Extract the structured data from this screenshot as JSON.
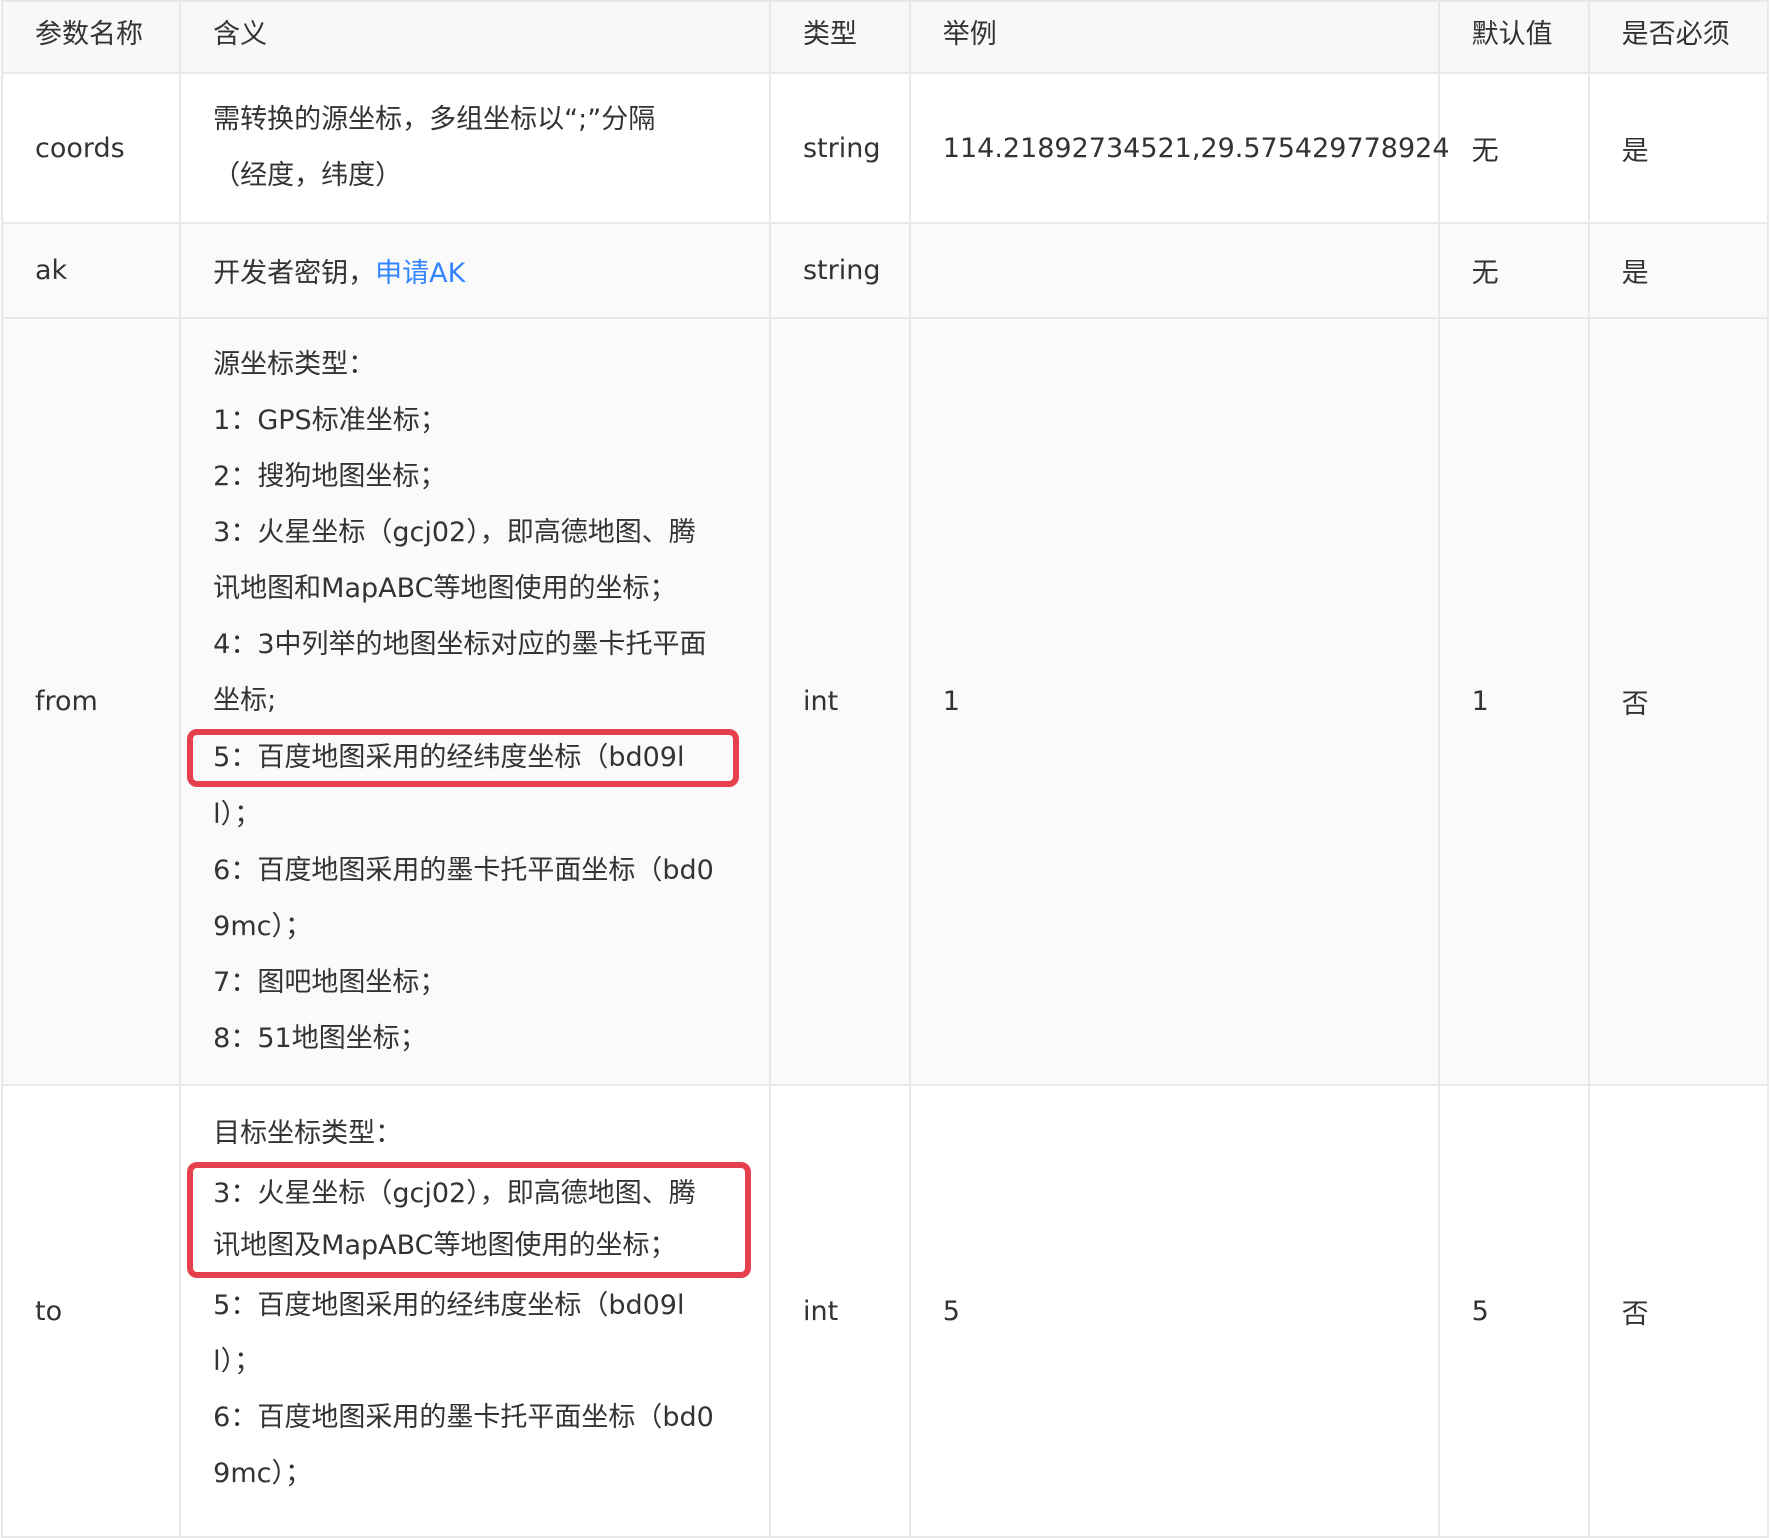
{
  "headers": {
    "name": "参数名称",
    "meaning": "含义",
    "type": "类型",
    "example": "举例",
    "default": "默认值",
    "required": "是否必须"
  },
  "rows": {
    "coords": {
      "name": "coords",
      "meaning_line1": "需转换的源坐标，多组坐标以“;”分隔",
      "meaning_line2": "（经度，纬度）",
      "type": "string",
      "example": "114.21892734521,29.575429778924",
      "default": "无",
      "required": "是"
    },
    "ak": {
      "name": "ak",
      "meaning_text": "开发者密钥，",
      "meaning_link": "申请AK",
      "type": "string",
      "example": "",
      "default": "无",
      "required": "是"
    },
    "from": {
      "name": "from",
      "lines": [
        "源坐标类型：",
        "1：GPS标准坐标；",
        "2：搜狗地图坐标；",
        "3：火星坐标（gcj02），即高德地图、腾",
        "讯地图和MapABC等地图使用的坐标；",
        "4：3中列举的地图坐标对应的墨卡托平面",
        "坐标;",
        "5：百度地图采用的经纬度坐标（bd09l",
        "l）；",
        "6：百度地图采用的墨卡托平面坐标（bd0",
        "9mc）；",
        "7：图吧地图坐标；",
        "8：51地图坐标；"
      ],
      "type": "int",
      "example": "1",
      "default": "1",
      "required": "否"
    },
    "to": {
      "name": "to",
      "lines": [
        "目标坐标类型：",
        "3：火星坐标（gcj02），即高德地图、腾",
        "讯地图及MapABC等地图使用的坐标；",
        "5：百度地图采用的经纬度坐标（bd09l",
        "l）；",
        "6：百度地图采用的墨卡托平面坐标（bd0",
        "9mc）；"
      ],
      "type": "int",
      "example": "5",
      "default": "5",
      "required": "否"
    }
  },
  "colors": {
    "highlight_border": "#e5404c",
    "link": "#3385ff",
    "header_bg": "#f7f8fa",
    "grid": "#e8e8e8"
  }
}
